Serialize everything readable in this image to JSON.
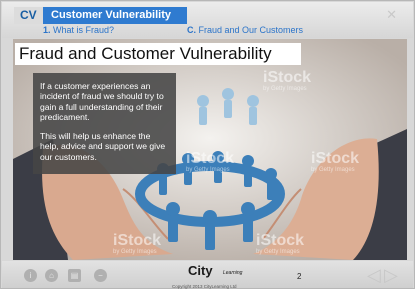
{
  "header": {
    "module_code": "CV",
    "module_title": "Customer Vulnerability",
    "nav": [
      {
        "number": "1.",
        "label": "What is Fraud?"
      },
      {
        "number": "C.",
        "label": "Fraud and Our Customers"
      }
    ],
    "close_icon": "close-icon"
  },
  "slide": {
    "title": "Fraud and Customer Vulnerability",
    "paragraphs": [
      "If a customer experiences an incident of fraud we should try to gain a full understanding of their predicament.",
      "This will help us enhance the help, advice and support we give our customers."
    ],
    "image": "hands-protecting-paper-people-circle",
    "watermarks": [
      {
        "brand": "iStock",
        "by": "by Getty Images"
      }
    ]
  },
  "footer": {
    "logo_text": "City",
    "logo_sub": "Learning",
    "copyright": "Copyright 2013 CityLearning Ltd",
    "page_number": "2",
    "controls": [
      "info-icon",
      "home-icon",
      "document-icon",
      "minus-icon"
    ],
    "prev_icon": "prev-arrow-icon",
    "next_icon": "next-arrow-icon"
  },
  "colors": {
    "accent_blue": "#2f7bd0",
    "link_blue": "#2b74c9",
    "overlay": "#464646"
  }
}
